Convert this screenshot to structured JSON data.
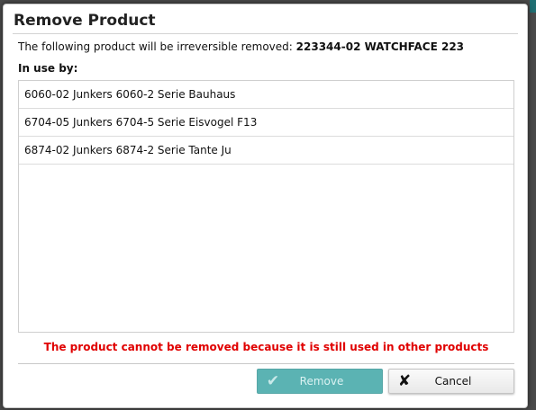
{
  "dialog": {
    "title": "Remove Product",
    "intro_text": "The following product will be irreversible removed:",
    "product_name": "223344-02 WATCHFACE 223",
    "in_use_label": "In use by:",
    "in_use_items": [
      "6060-02 Junkers 6060-2 Serie Bauhaus",
      "6704-05 Junkers 6704-5 Serie Eisvogel F13",
      "6874-02 Junkers 6874-2 Serie Tante Ju"
    ],
    "error_message": "The product cannot be removed because it is still used in other products",
    "buttons": {
      "remove_label": "Remove",
      "remove_icon": "check-icon",
      "remove_disabled": true,
      "cancel_label": "Cancel",
      "cancel_icon": "x-icon"
    }
  },
  "colors": {
    "error": "#e00000",
    "accent": "#3fa6a6"
  }
}
